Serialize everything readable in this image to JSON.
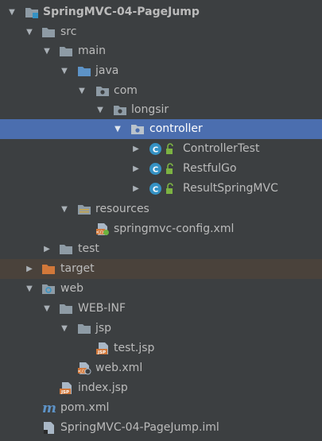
{
  "project_tree": {
    "items": [
      {
        "label": "SpringMVC-04-PageJump",
        "icon": "project-folder-icon",
        "expanded": true
      },
      {
        "label": "src",
        "icon": "folder-icon",
        "expanded": true
      },
      {
        "label": "main",
        "icon": "folder-icon",
        "expanded": true
      },
      {
        "label": "java",
        "icon": "source-root-folder-icon",
        "expanded": true
      },
      {
        "label": "com",
        "icon": "package-icon",
        "expanded": true
      },
      {
        "label": "longsir",
        "icon": "package-icon",
        "expanded": true
      },
      {
        "label": "controller",
        "icon": "package-icon",
        "expanded": true,
        "selected": true
      },
      {
        "label": "ControllerTest",
        "icon": "java-class-icon",
        "expanded": false
      },
      {
        "label": "RestfulGo",
        "icon": "java-class-icon",
        "expanded": false
      },
      {
        "label": "ResultSpringMVC",
        "icon": "java-class-icon",
        "expanded": false
      },
      {
        "label": "resources",
        "icon": "resources-folder-icon",
        "expanded": true
      },
      {
        "label": "springmvc-config.xml",
        "icon": "spring-xml-file-icon"
      },
      {
        "label": "test",
        "icon": "folder-icon",
        "expanded": false
      },
      {
        "label": "target",
        "icon": "excluded-folder-icon",
        "expanded": false,
        "excluded": true
      },
      {
        "label": "web",
        "icon": "web-folder-icon",
        "expanded": true
      },
      {
        "label": "WEB-INF",
        "icon": "folder-icon",
        "expanded": true
      },
      {
        "label": "jsp",
        "icon": "folder-icon",
        "expanded": true
      },
      {
        "label": "test.jsp",
        "icon": "jsp-file-icon"
      },
      {
        "label": "web.xml",
        "icon": "web-xml-file-icon"
      },
      {
        "label": "index.jsp",
        "icon": "jsp-file-icon"
      },
      {
        "label": "pom.xml",
        "icon": "maven-file-icon"
      },
      {
        "label": "SpringMVC-04-PageJump.iml",
        "icon": "iml-file-icon"
      }
    ]
  },
  "colors": {
    "background": "#3c3f41",
    "selected_row": "#4b6eaf",
    "excluded_row": "#4a423b",
    "text": "#bbbbbb",
    "folder": "#8e9ba5",
    "source_folder": "#5d93c7",
    "excluded_folder": "#d2783a",
    "class_badge": "#3592c4",
    "lock_green": "#7cb342"
  }
}
